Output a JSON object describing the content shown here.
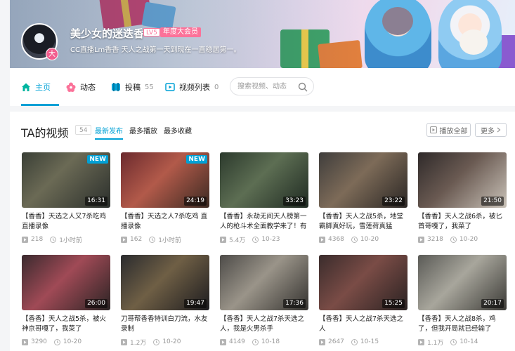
{
  "profile": {
    "name": "美少女的迷迭香",
    "level": "LV5",
    "vip": "年度大会员",
    "avatar_badge": "大",
    "sign": "CC直播Lm香香 天人之战第一天到现在一直稳居第一。"
  },
  "nav": {
    "items": [
      {
        "label": "主页",
        "count": "",
        "icon": "home-icon"
      },
      {
        "label": "动态",
        "count": "",
        "icon": "flower-icon"
      },
      {
        "label": "投稿",
        "count": "55",
        "icon": "upload-icon"
      },
      {
        "label": "视频列表",
        "count": "0",
        "icon": "playlist-icon"
      }
    ],
    "search_placeholder": "搜索视频、动态"
  },
  "section": {
    "title": "TA的视频",
    "count": "54",
    "sorts": [
      "最新发布",
      "最多播放",
      "最多收藏"
    ],
    "play_all": "播放全部",
    "more": "更多"
  },
  "videos": [
    {
      "title": "【香香】天选之人又7杀吃鸡直播录像",
      "duration": "16:31",
      "badge": "NEW",
      "plays": "218",
      "time": "1小时前"
    },
    {
      "title": "【香香】天选之人7杀吃鸡 直播录像",
      "duration": "24:19",
      "badge": "NEW",
      "plays": "162",
      "time": "1小时前"
    },
    {
      "title": "【香香】永劫无间天人榜第一人的枪斗术全面教学来了！有",
      "duration": "33:23",
      "badge": "",
      "plays": "5.4万",
      "time": "10-23"
    },
    {
      "title": "【香香】天人之战5杀，地堂霸脚真好玩，雪莲荷真猛",
      "duration": "23:22",
      "badge": "",
      "plays": "4368",
      "time": "10-20"
    },
    {
      "title": "【香香】天人之战6杀，被匕首哥嘎了，我菜了",
      "duration": "21:50",
      "badge": "",
      "plays": "3218",
      "time": "10-20"
    },
    {
      "title": "【香香】天人之战5杀，被火神京哥嘎了，我菜了",
      "duration": "26:00",
      "badge": "",
      "plays": "3290",
      "time": "10-20"
    },
    {
      "title": "刀哥帮香香特训白刀流，水友录制",
      "duration": "19:47",
      "badge": "",
      "plays": "1.2万",
      "time": "10-20"
    },
    {
      "title": "【香香】天人之战7杀天选之人，我是火男杀手",
      "duration": "17:36",
      "badge": "",
      "plays": "4149",
      "time": "10-18"
    },
    {
      "title": "【香香】天人之战7杀天选之人",
      "duration": "15:25",
      "badge": "",
      "plays": "2647",
      "time": "10-15"
    },
    {
      "title": "【香香】天人之战8杀，鸡了，但我开局就已经输了",
      "duration": "20:17",
      "badge": "",
      "plays": "1.1万",
      "time": "10-14"
    }
  ],
  "colors": {
    "accent": "#00a1d6",
    "pink": "#fb7299"
  }
}
